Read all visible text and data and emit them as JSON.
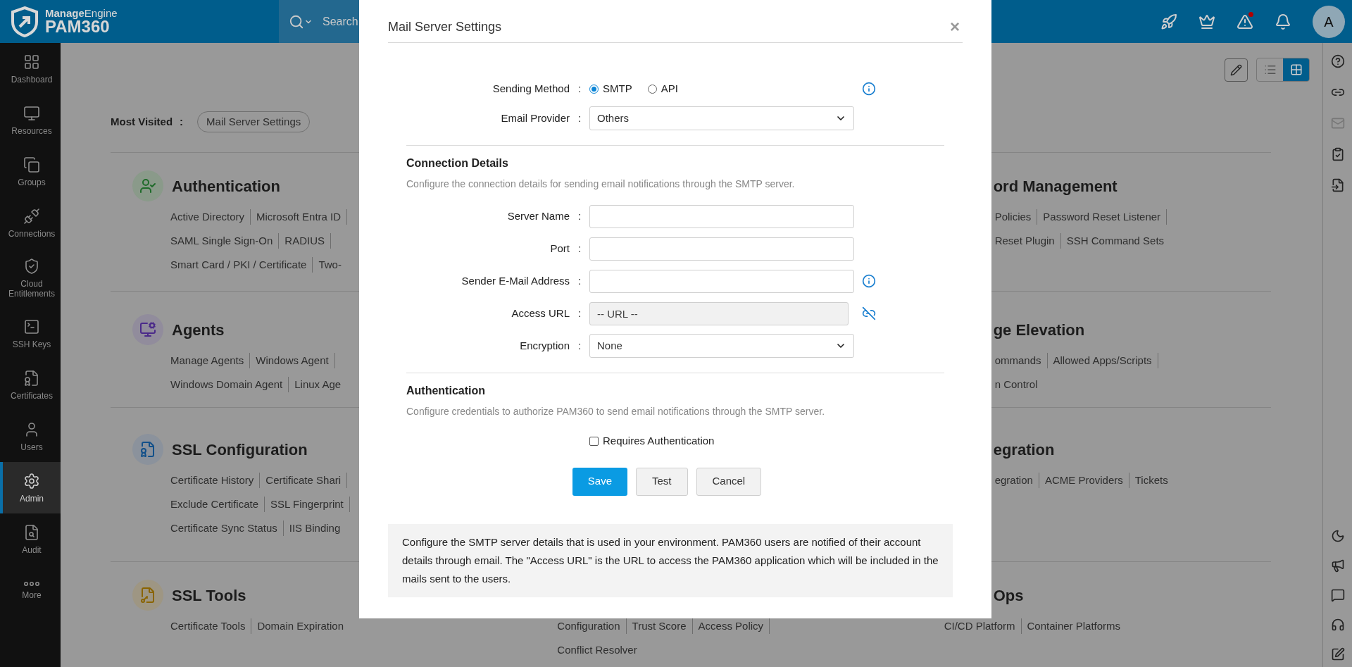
{
  "header": {
    "brand_top": "**Manage**Engine",
    "brand": "PAM360",
    "search_placeholder": "Search",
    "avatar": "A",
    "alert_badge": true
  },
  "sidebar": [
    {
      "label": "Dashboard",
      "selected": false
    },
    {
      "label": "Resources",
      "selected": false
    },
    {
      "label": "Groups",
      "selected": false
    },
    {
      "label": "Connections",
      "selected": false
    },
    {
      "label": "Cloud Entitlements",
      "selected": false
    },
    {
      "label": "SSH Keys",
      "selected": false
    },
    {
      "label": "Certificates",
      "selected": false
    },
    {
      "label": "Users",
      "selected": false
    },
    {
      "label": "Admin",
      "selected": true
    },
    {
      "label": "Audit",
      "selected": false
    },
    {
      "label": "More",
      "selected": false
    }
  ],
  "toolbar": {
    "view_toggle": [
      {
        "selected": false
      },
      {
        "selected": true
      }
    ]
  },
  "most_visited": {
    "label": "Most Visited",
    "colon": ":",
    "chips": [
      "Mail Server Settings"
    ]
  },
  "bands": [
    {
      "left": {
        "kind": "user",
        "title": {
          "text": "Authentication"
        },
        "rows": [
          {
            "items": [
              "Active Directory",
              "Microsoft Entra ID"
            ]
          },
          {
            "items": [
              "SAML Single Sign-On",
              "RADIUS"
            ]
          },
          {
            "items": [
              "Smart Card / PKI / Certificate",
              "Two-"
            ]
          }
        ]
      },
      "right": {
        "title": {
          "text": "ord Management",
          "starts_under_dialog": true
        },
        "rows": [
          {
            "items": [
              "Policies",
              "Password Reset Listener"
            ],
            "starts_under_dialog": true
          },
          {
            "items": [
              "Reset Plugin",
              "SSH Command Sets"
            ],
            "starts_under_dialog": true
          }
        ]
      }
    },
    {
      "left": {
        "kind": "agent",
        "title": {
          "text": "Agents"
        },
        "rows": [
          {
            "items": [
              "Manage Agents",
              "Windows Agent"
            ]
          },
          {
            "items": [
              "Windows Domain Agent",
              "Linux Age"
            ]
          }
        ]
      },
      "right": {
        "title": {
          "text": "ge Elevation",
          "starts_under_dialog": true
        },
        "rows": [
          {
            "items": [
              "ommands",
              "Allowed Apps/Scripts"
            ],
            "starts_under_dialog": true
          },
          {
            "items": [
              "n Control"
            ],
            "starts_under_dialog": true
          }
        ]
      }
    },
    {
      "left": {
        "kind": "certificate",
        "title": {
          "text": "SSL Configuration"
        },
        "rows": [
          {
            "items": [
              "Certificate History",
              "Certificate Shari"
            ]
          },
          {
            "items": [
              "Exclude Certificate",
              "SSL Fingerprint"
            ]
          },
          {
            "items": [
              "Certificate Sync Status",
              "IIS Binding"
            ]
          }
        ]
      },
      "right": {
        "title": {
          "text": "egration",
          "starts_under_dialog": true
        },
        "rows": [
          {
            "items": [
              "egration",
              "ACME Providers",
              "Tickets"
            ],
            "starts_under_dialog": true
          }
        ]
      }
    },
    {
      "left": {
        "kind": "tool",
        "title": {
          "text": "SSL Tools"
        },
        "rows": [
          {
            "items": [
              "Certificate Tools",
              "Domain Expiration"
            ]
          }
        ]
      },
      "middle": {
        "rows": [
          {
            "items": [
              "Configuration",
              "Trust Score",
              "Access Policy"
            ]
          },
          {
            "items": [
              "Conflict Resolver"
            ]
          }
        ]
      },
      "right": {
        "title": {
          "text": "Ops",
          "starts_under_dialog": true
        },
        "rows": [
          {
            "items": [
              "CI/CD Platform",
              "Container Platforms"
            ]
          }
        ]
      }
    }
  ],
  "dialog": {
    "title": "Mail Server Settings",
    "close": "×",
    "top_fields": [
      {
        "kind": "radio",
        "label": "Sending Method",
        "colon": ":",
        "options": [
          {
            "label": "SMTP",
            "selected": true
          },
          {
            "label": "API",
            "selected": false
          }
        ],
        "info_button": true
      },
      {
        "kind": "select",
        "label": "Email Provider",
        "colon": ":",
        "value": "Others"
      }
    ],
    "sections": [
      {
        "heading": "Connection Details",
        "description": "Configure the connection details for sending email notifications through the SMTP server.",
        "fields": [
          {
            "kind": "text",
            "label": "Server Name",
            "colon": ":",
            "disabled": false
          },
          {
            "kind": "text",
            "label": "Port",
            "colon": ":",
            "disabled": false
          },
          {
            "kind": "text",
            "label": "Sender E-Mail Address",
            "colon": ":",
            "disabled": false,
            "info_button": true
          },
          {
            "kind": "text",
            "label": "Access URL",
            "colon": ":",
            "placeholder": "-- URL --",
            "disabled": true,
            "link_toggle": true
          },
          {
            "kind": "select",
            "label": "Encryption",
            "colon": ":",
            "value": "None"
          }
        ]
      },
      {
        "heading": "Authentication",
        "description": "Configure credentials to authorize PAM360 to send email notifications through the SMTP server."
      }
    ],
    "checkbox": {
      "label": "Requires Authentication",
      "checked": false
    },
    "buttons": [
      {
        "label": "Save",
        "kind": "primary"
      },
      {
        "label": "Test",
        "kind": "secondary"
      },
      {
        "label": "Cancel",
        "kind": "secondary"
      }
    ],
    "note": "Configure the SMTP server details that is used in your environment. PAM360 users are notified of their account details through email. The \"Access URL\" is the URL to access the PAM360 application which will be included in the mails sent to the users."
  }
}
